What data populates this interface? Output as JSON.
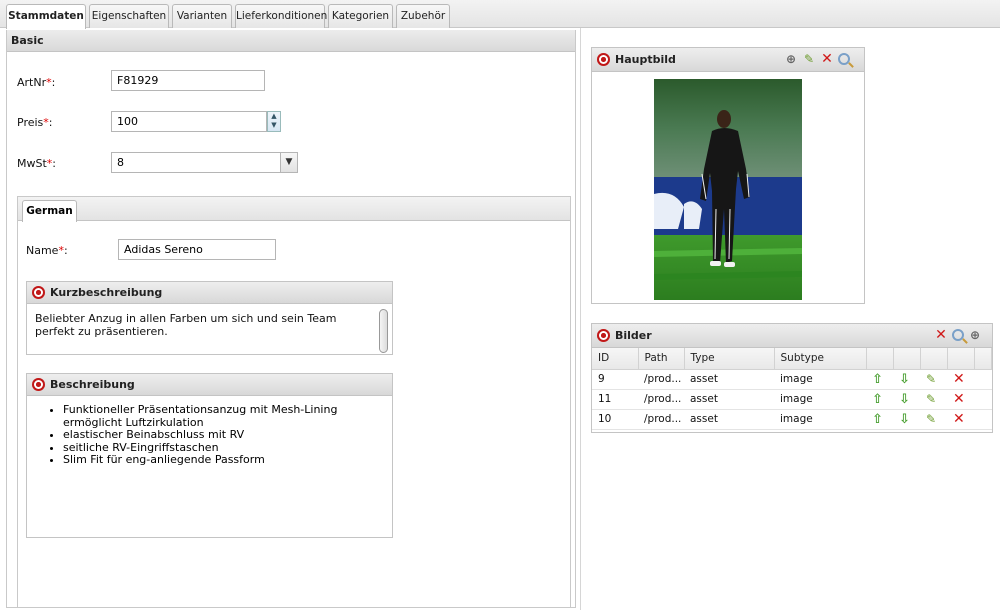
{
  "tabs": [
    {
      "label": "Stammdaten",
      "active": true
    },
    {
      "label": "Eigenschaften",
      "active": false
    },
    {
      "label": "Varianten",
      "active": false
    },
    {
      "label": "Lieferkonditionen",
      "active": false
    },
    {
      "label": "Kategorien",
      "active": false
    },
    {
      "label": "Zubehör",
      "active": false
    }
  ],
  "basic": {
    "title": "Basic",
    "artnr": {
      "label": "ArtNr",
      "required": "*",
      "colon": ":",
      "value": "F81929"
    },
    "preis": {
      "label": "Preis",
      "required": "*",
      "colon": ":",
      "value": "100"
    },
    "mwst": {
      "label": "MwSt",
      "required": "*",
      "colon": ":",
      "value": "8"
    }
  },
  "language_tab": {
    "label": "German",
    "name": {
      "label": "Name",
      "required": "*",
      "colon": ":",
      "value": "Adidas Sereno"
    },
    "kurzbeschreibung": {
      "title": "Kurzbeschreibung",
      "text": "Beliebter Anzug in allen Farben um sich und sein Team perfekt zu präsentieren."
    },
    "beschreibung": {
      "title": "Beschreibung",
      "items": [
        "Funktioneller Präsentationsanzug mit Mesh-Lining ermöglicht Luftzirkulation",
        "elastischer Beinabschluss mit RV",
        "seitliche RV-Eingriffstaschen",
        "Slim Fit für eng-anliegende Passform"
      ]
    }
  },
  "hauptbild": {
    "title": "Hauptbild",
    "tools": [
      "add-image-icon",
      "edit-icon",
      "delete-icon",
      "search-icon"
    ]
  },
  "bilder": {
    "title": "Bilder",
    "tools": [
      "delete-icon",
      "search-icon",
      "add-image-icon"
    ],
    "columns": [
      "ID",
      "Path",
      "Type",
      "Subtype"
    ],
    "rows": [
      {
        "id": "9",
        "path": "/prod...",
        "type": "asset",
        "subtype": "image"
      },
      {
        "id": "11",
        "path": "/prod...",
        "type": "asset",
        "subtype": "image"
      },
      {
        "id": "10",
        "path": "/prod...",
        "type": "asset",
        "subtype": "image"
      }
    ]
  },
  "colors": {
    "required": "#dd0000",
    "delete": "#d01818",
    "move": "#4aa032"
  }
}
